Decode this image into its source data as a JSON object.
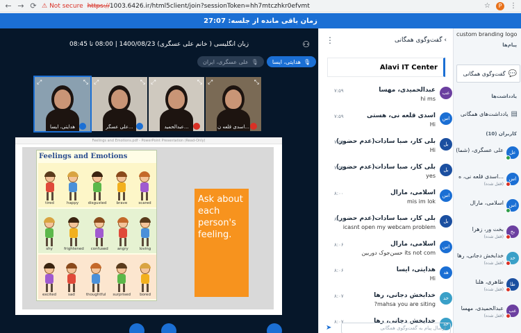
{
  "browser": {
    "security_label": "Not secure",
    "url_scheme": "https://",
    "url_rest": "1003.6426.ir/html5client/join?sessionToken=hh7mtczhkr0efvmt",
    "profile_initial": "P"
  },
  "timer": {
    "text": "زمان باقی مانده از جلسه: 27:07"
  },
  "main": {
    "session_title": "زبان انگلیسی ( خانم علی عسگری) 1400/08/23 | 08:00 تا 08:45",
    "talkers": [
      {
        "label": "هدایتی، ایسا",
        "active": true
      },
      {
        "label": "علی عسگری، ایران",
        "active": false
      }
    ],
    "webcams": [
      {
        "label": "هدایتی، ایسا",
        "highlight": true,
        "muted": false
      },
      {
        "label": "علی عسگر...",
        "highlight": false,
        "muted": false
      },
      {
        "label": "عبدالحمید...",
        "highlight": false,
        "muted": true
      },
      {
        "label": "اسدی قلعه ن...",
        "highlight": false,
        "muted": true
      }
    ],
    "slide": {
      "header_text": "Feelings and Emotions.pdf - PowerPoint Presentation (Read-Only)",
      "emotions_title": "Feelings and Emotions",
      "rows": [
        {
          "bg": "#fdf6c8",
          "items": [
            "tired",
            "happy",
            "disgusted",
            "brave",
            "scared"
          ]
        },
        {
          "bg": "#e6f2d2",
          "items": [
            "shy",
            "frightened",
            "confused",
            "angry",
            "loving"
          ]
        },
        {
          "bg": "#fce6cf",
          "items": [
            "excited",
            "sad",
            "thoughtful",
            "surprised",
            "bored"
          ]
        }
      ],
      "ask_text": "Ask about each person's feeling."
    }
  },
  "chat": {
    "title": "گفت‌وگوی همگانی",
    "welcome": "Alavi IT Center",
    "input_placeholder": "ارسال پیام به گفت‌وگوی همگانی",
    "messages": [
      {
        "initials": "عب",
        "color": "#6b3fa0",
        "name": "عبدالحمیدی، مهسا",
        "time": "۷:۵۹",
        "text": "hi ms"
      },
      {
        "initials": "اس",
        "color": "#1b6fd4",
        "name": "اسدی قلعه نی، هستی",
        "time": "۷:۵۹",
        "text": "Hi"
      },
      {
        "initials": "بل",
        "color": "#1b4fa0",
        "name": "بلی کار، صبا سادات(عدم حضور)",
        "time": "۷:۵۹",
        "text": "Hi"
      },
      {
        "initials": "بل",
        "color": "#1b4fa0",
        "name": "بلی کار، صبا سادات(عدم حضور)",
        "time": "۷:۵۹",
        "text": "yes"
      },
      {
        "initials": "اس",
        "color": "#1b6fd4",
        "name": "اسلامی، مارال",
        "time": "۸:۰۰",
        "text": "mis im lok"
      },
      {
        "initials": "بل",
        "color": "#1b4fa0",
        "name": "بلی کار، صبا سادات(عدم حضور)",
        "time": "۸:۰۰",
        "text": "icasnt open my webcam problem"
      },
      {
        "initials": "اس",
        "color": "#1b6fd4",
        "name": "اسلامی، مارال",
        "time": "۸:۰۶",
        "text": "حسن‌جوک دوربین its not com"
      },
      {
        "initials": "هد",
        "color": "#1b6fd4",
        "name": "هدایتی، ایسا",
        "time": "۸:۰۶",
        "text": "Hi"
      },
      {
        "initials": "خد",
        "color": "#3aa0c8",
        "name": "خدابخش دجانی، رها",
        "time": "۸:۰۷",
        "text": "?mahsa you are siting"
      },
      {
        "initials": "خد",
        "color": "#3aa0c8",
        "name": "خدابخش دجانی، رها",
        "time": "۸:۰۷",
        "text": ""
      }
    ]
  },
  "sidebar": {
    "brand": "custom branding logo",
    "messages_title": "پیام‌ها",
    "chat_item": "گفت‌وگوی همگانی",
    "notes_title": "یادداشت‌ها",
    "notes_item": "یادداشت‌های همگانی",
    "users_title": "کاربران (10)",
    "users": [
      {
        "initials": "عل",
        "color": "#1b6fd4",
        "name": "علی عسگری، (شما)",
        "sub": "",
        "status": "#2e9c4a",
        "ring": true
      },
      {
        "initials": "اس",
        "color": "#1b6fd4",
        "name": "اسدی قلعه نی، ه...",
        "sub": "(قفل شده)",
        "status": "#d93025",
        "ring": false
      },
      {
        "initials": "اس",
        "color": "#1b6fd4",
        "name": "اسلامی، مارال",
        "sub": "",
        "status": "#2e9c4a",
        "ring": false
      },
      {
        "initials": "بخ",
        "color": "#6b3fa0",
        "name": "بخت ور، زهرا",
        "sub": "(قفل شده)",
        "status": "#d93025",
        "ring": false
      },
      {
        "initials": "خد",
        "color": "#3aa0c8",
        "name": "خدابخش دجانی، رها",
        "sub": "(قفل شده)",
        "status": "#d93025",
        "ring": false
      },
      {
        "initials": "طا",
        "color": "#1b4fa0",
        "name": "طاهری، هلنا",
        "sub": "(قفل شده)",
        "status": "#d93025",
        "ring": false
      },
      {
        "initials": "عب",
        "color": "#6b3fa0",
        "name": "عبدالحمیدی، مهسا",
        "sub": "(قفل شده)",
        "status": "#d93025",
        "ring": false
      }
    ]
  }
}
